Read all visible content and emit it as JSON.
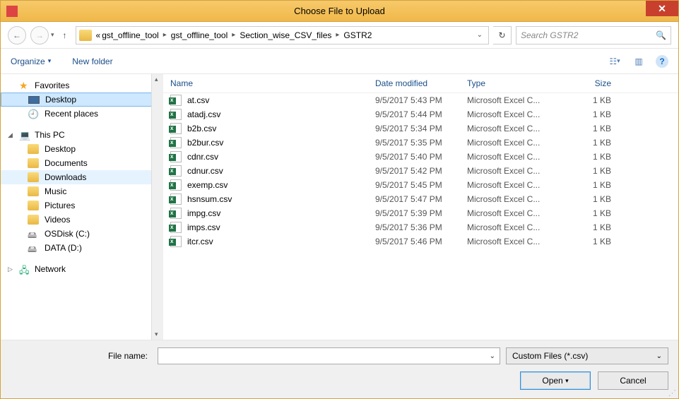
{
  "window": {
    "title": "Choose File to Upload"
  },
  "breadcrumb": {
    "segments": [
      "gst_offline_tool",
      "gst_offline_tool",
      "Section_wise_CSV_files",
      "GSTR2"
    ],
    "prefix": "«"
  },
  "search": {
    "placeholder": "Search GSTR2"
  },
  "toolbar": {
    "organize": "Organize",
    "newfolder": "New folder"
  },
  "sidebar": {
    "favorites": {
      "label": "Favorites"
    },
    "desktop": {
      "label": "Desktop"
    },
    "recent": {
      "label": "Recent places"
    },
    "thispc": {
      "label": "This PC"
    },
    "pc_items": [
      {
        "label": "Desktop"
      },
      {
        "label": "Documents"
      },
      {
        "label": "Downloads"
      },
      {
        "label": "Music"
      },
      {
        "label": "Pictures"
      },
      {
        "label": "Videos"
      },
      {
        "label": "OSDisk (C:)"
      },
      {
        "label": "DATA (D:)"
      }
    ],
    "network": {
      "label": "Network"
    }
  },
  "columns": {
    "name": "Name",
    "date": "Date modified",
    "type": "Type",
    "size": "Size"
  },
  "files": [
    {
      "name": "at.csv",
      "date": "9/5/2017 5:43 PM",
      "type": "Microsoft Excel C...",
      "size": "1 KB"
    },
    {
      "name": "atadj.csv",
      "date": "9/5/2017 5:44 PM",
      "type": "Microsoft Excel C...",
      "size": "1 KB"
    },
    {
      "name": "b2b.csv",
      "date": "9/5/2017 5:34 PM",
      "type": "Microsoft Excel C...",
      "size": "1 KB"
    },
    {
      "name": "b2bur.csv",
      "date": "9/5/2017 5:35 PM",
      "type": "Microsoft Excel C...",
      "size": "1 KB"
    },
    {
      "name": "cdnr.csv",
      "date": "9/5/2017 5:40 PM",
      "type": "Microsoft Excel C...",
      "size": "1 KB"
    },
    {
      "name": "cdnur.csv",
      "date": "9/5/2017 5:42 PM",
      "type": "Microsoft Excel C...",
      "size": "1 KB"
    },
    {
      "name": "exemp.csv",
      "date": "9/5/2017 5:45 PM",
      "type": "Microsoft Excel C...",
      "size": "1 KB"
    },
    {
      "name": "hsnsum.csv",
      "date": "9/5/2017 5:47 PM",
      "type": "Microsoft Excel C...",
      "size": "1 KB"
    },
    {
      "name": "impg.csv",
      "date": "9/5/2017 5:39 PM",
      "type": "Microsoft Excel C...",
      "size": "1 KB"
    },
    {
      "name": "imps.csv",
      "date": "9/5/2017 5:36 PM",
      "type": "Microsoft Excel C...",
      "size": "1 KB"
    },
    {
      "name": "itcr.csv",
      "date": "9/5/2017 5:46 PM",
      "type": "Microsoft Excel C...",
      "size": "1 KB"
    }
  ],
  "footer": {
    "filename_label": "File name:",
    "filter": "Custom Files (*.csv)",
    "open": "Open",
    "cancel": "Cancel"
  }
}
